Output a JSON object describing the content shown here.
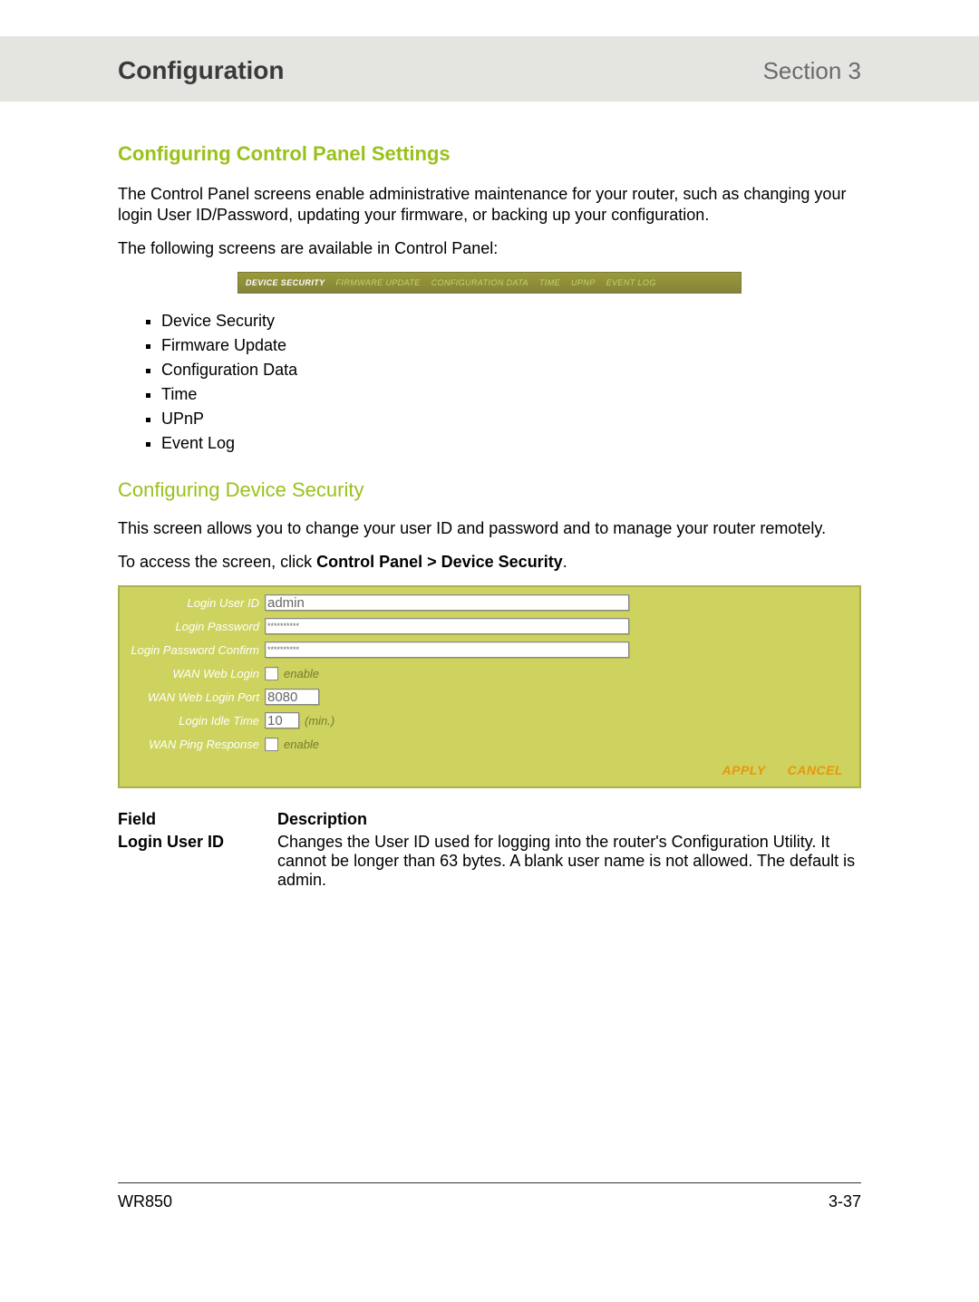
{
  "header": {
    "title": "Configuration",
    "section": "Section 3"
  },
  "section1": {
    "heading": "Configuring Control Panel Settings",
    "intro": "The Control Panel screens enable administrative maintenance for your router, such as changing your login User ID/Password, updating your firmware, or backing up your configuration.",
    "available": "The following screens are available in Control Panel:",
    "tabs": {
      "active": "DEVICE SECURITY",
      "inactive": [
        "FIRMWARE UPDATE",
        "CONFIGURATION DATA",
        "TIME",
        "UPNP",
        "EVENT LOG"
      ]
    },
    "bullets": [
      "Device Security",
      "Firmware Update",
      "Configuration Data",
      "Time",
      "UPnP",
      "Event Log"
    ]
  },
  "section2": {
    "heading": "Configuring Device Security",
    "intro": "This screen allows you to change your user ID and password and to manage your router remotely.",
    "access_prefix": "To access the screen, click ",
    "access_path": "Control Panel > Device Security",
    "access_suffix": "."
  },
  "panel": {
    "labels": {
      "user_id": "Login User ID",
      "password": "Login Password",
      "password_confirm": "Login Password Confirm",
      "wan_web_login": "WAN Web Login",
      "wan_web_login_port": "WAN Web Login Port",
      "login_idle_time": "Login Idle Time",
      "wan_ping_response": "WAN Ping Response"
    },
    "values": {
      "user_id": "admin",
      "password": "**********",
      "password_confirm": "**********",
      "wan_web_login_port": "8080",
      "login_idle_time": "10"
    },
    "aux": {
      "enable": "enable",
      "min": "(min.)"
    },
    "buttons": {
      "apply": "APPLY",
      "cancel": "CANCEL"
    }
  },
  "table": {
    "headers": {
      "field": "Field",
      "description": "Description"
    },
    "rows": [
      {
        "field": "Login User ID",
        "description": "Changes the User ID used for logging into the router's Configuration Utility. It cannot be longer than 63 bytes. A blank user name is not allowed. The default is admin."
      }
    ]
  },
  "footer": {
    "model": "WR850",
    "page": "3-37"
  }
}
